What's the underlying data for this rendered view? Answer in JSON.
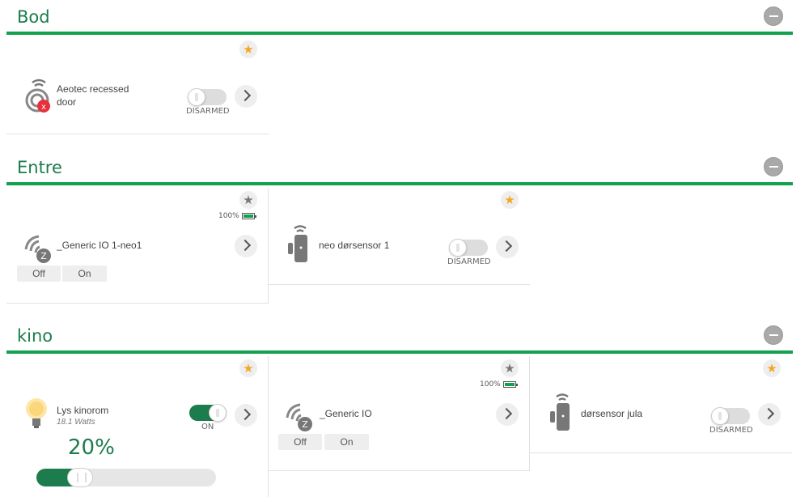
{
  "sections": [
    {
      "title": "Bod",
      "devices": [
        {
          "name": "Aeotec recessed door",
          "toggle_label": "DISARMED",
          "favorite": true
        }
      ]
    },
    {
      "title": "Entre",
      "devices": [
        {
          "name": "_Generic IO 1-neo1",
          "battery": "100%",
          "favorite": false,
          "buttons": [
            "Off",
            "On"
          ]
        },
        {
          "name": "neo dørsensor 1",
          "toggle_label": "DISARMED",
          "favorite": true
        }
      ]
    },
    {
      "title": "kino",
      "devices": [
        {
          "name": "Lys kinorom",
          "power": "18.1 Watts",
          "toggle_label": "ON",
          "favorite": true,
          "dim_level": "20%",
          "dim_fraction": 0.2
        },
        {
          "name": "_Generic IO",
          "battery": "100%",
          "favorite": false,
          "buttons": [
            "Off",
            "On"
          ]
        },
        {
          "name": "dørsensor jula",
          "toggle_label": "DISARMED",
          "favorite": true
        }
      ]
    }
  ],
  "icons": {
    "star": "★",
    "accent_color": "#1c7c4d",
    "line_color": "#13a04f",
    "favorite_color": "#f5a623"
  }
}
